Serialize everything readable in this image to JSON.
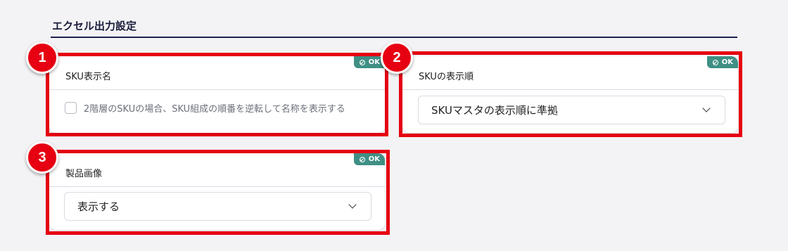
{
  "section": {
    "title": "エクセル出力設定"
  },
  "cards": [
    {
      "marker": "1",
      "title": "SKU表示名",
      "badge": "OK",
      "checkbox_label": "2階層のSKUの場合、SKU組成の順番を逆転して名称を表示する",
      "checked": false
    },
    {
      "marker": "2",
      "title": "SKUの表示順",
      "badge": "OK",
      "select_value": "SKUマスタの表示順に準拠"
    },
    {
      "marker": "3",
      "title": "製品画像",
      "badge": "OK",
      "select_value": "表示する"
    }
  ],
  "colors": {
    "accent_red": "#e60012",
    "ok_badge": "#3f8f84",
    "title_rule": "#1c2150"
  },
  "icons": {
    "badge": "check-circle-icon",
    "select": "chevron-down-icon"
  }
}
